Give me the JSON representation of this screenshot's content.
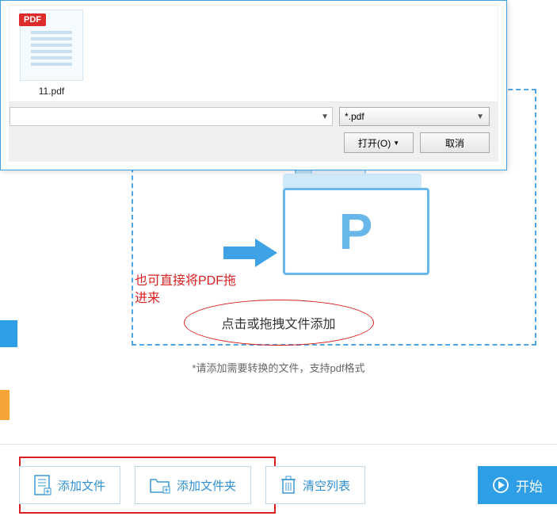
{
  "dialog": {
    "file_thumb": {
      "badge": "PDF",
      "name": "11.pdf"
    },
    "filter_value": "*.pdf",
    "open_label": "打开(O)",
    "cancel_label": "取消"
  },
  "drop_zone": {
    "logo_letter": "P",
    "drag_instruction_line1": "也可直接将PDF拖",
    "drag_instruction_line2": "进来",
    "click_drag_text": "点击或拖拽文件添加",
    "hint": "*请添加需要转换的文件，支持pdf格式"
  },
  "toolbar": {
    "add_file": "添加文件",
    "add_folder": "添加文件夹",
    "clear_list": "清空列表",
    "start": "开始"
  }
}
